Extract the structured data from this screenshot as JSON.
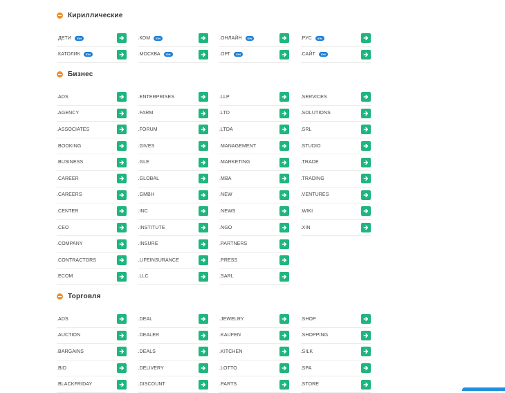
{
  "colors": {
    "accent": "#1fb57f",
    "section_dot": "#f0902c",
    "badge": "#1e7fd6"
  },
  "sections": [
    {
      "title": "Кириллические",
      "icon": "minus-circle-icon",
      "columns": [
        [
          {
            "tld": ".ДЕТИ",
            "badge": "IDN"
          },
          {
            "tld": ".КАТОЛИК",
            "badge": "IDN"
          }
        ],
        [
          {
            "tld": ".КОМ",
            "badge": "IDN"
          },
          {
            "tld": ".МОСКВА",
            "badge": "IDN"
          }
        ],
        [
          {
            "tld": ".ОНЛАЙН",
            "badge": "IDN"
          },
          {
            "tld": ".ОРГ",
            "badge": "IDN"
          }
        ],
        [
          {
            "tld": ".РУС",
            "badge": "IDN"
          },
          {
            "tld": ".САЙТ",
            "badge": "IDN"
          }
        ]
      ]
    },
    {
      "title": "Бизнес",
      "icon": "minus-circle-icon",
      "columns": [
        [
          {
            "tld": ".ADS"
          },
          {
            "tld": ".AGENCY"
          },
          {
            "tld": ".ASSOCIATES"
          },
          {
            "tld": ".BOOKING"
          },
          {
            "tld": ".BUSINESS"
          },
          {
            "tld": ".CAREER"
          },
          {
            "tld": ".CAREERS"
          },
          {
            "tld": ".CENTER"
          },
          {
            "tld": ".CEO"
          },
          {
            "tld": ".COMPANY"
          },
          {
            "tld": ".CONTRACTORS"
          },
          {
            "tld": ".ECOM"
          }
        ],
        [
          {
            "tld": ".ENTERPRISES"
          },
          {
            "tld": ".FARM"
          },
          {
            "tld": ".FORUM"
          },
          {
            "tld": ".GIVES"
          },
          {
            "tld": ".GLE"
          },
          {
            "tld": ".GLOBAL"
          },
          {
            "tld": ".GMBH"
          },
          {
            "tld": ".INC"
          },
          {
            "tld": ".INSTITUTE"
          },
          {
            "tld": ".INSURE"
          },
          {
            "tld": ".LIFEINSURANCE"
          },
          {
            "tld": ".LLC"
          }
        ],
        [
          {
            "tld": ".LLP"
          },
          {
            "tld": ".LTD"
          },
          {
            "tld": ".LTDA"
          },
          {
            "tld": ".MANAGEMENT"
          },
          {
            "tld": ".MARKETING"
          },
          {
            "tld": ".MBA"
          },
          {
            "tld": ".NEW"
          },
          {
            "tld": ".NEWS"
          },
          {
            "tld": ".NGO"
          },
          {
            "tld": ".PARTNERS"
          },
          {
            "tld": ".PRESS"
          },
          {
            "tld": ".SARL"
          }
        ],
        [
          {
            "tld": ".SERVICES"
          },
          {
            "tld": ".SOLUTIONS"
          },
          {
            "tld": ".SRL"
          },
          {
            "tld": ".STUDIO"
          },
          {
            "tld": ".TRADE"
          },
          {
            "tld": ".TRADING"
          },
          {
            "tld": ".VENTURES"
          },
          {
            "tld": ".WIKI"
          },
          {
            "tld": ".XIN"
          }
        ]
      ]
    },
    {
      "title": "Торговля",
      "icon": "minus-circle-icon",
      "columns": [
        [
          {
            "tld": ".ADS"
          },
          {
            "tld": ".AUCTION"
          },
          {
            "tld": ".BARGAINS"
          },
          {
            "tld": ".BID"
          },
          {
            "tld": ".BLACKFRIDAY"
          }
        ],
        [
          {
            "tld": ".DEAL"
          },
          {
            "tld": ".DEALER"
          },
          {
            "tld": ".DEALS"
          },
          {
            "tld": ".DELIVERY"
          },
          {
            "tld": ".DISCOUNT"
          }
        ],
        [
          {
            "tld": ".JEWELRY"
          },
          {
            "tld": ".KAUFEN"
          },
          {
            "tld": ".KITCHEN"
          },
          {
            "tld": ".LOTTO"
          },
          {
            "tld": ".PARTS"
          }
        ],
        [
          {
            "tld": ".SHOP"
          },
          {
            "tld": ".SHOPPING"
          },
          {
            "tld": ".SILK"
          },
          {
            "tld": ".SPA"
          },
          {
            "tld": ".STORE"
          }
        ]
      ]
    }
  ]
}
